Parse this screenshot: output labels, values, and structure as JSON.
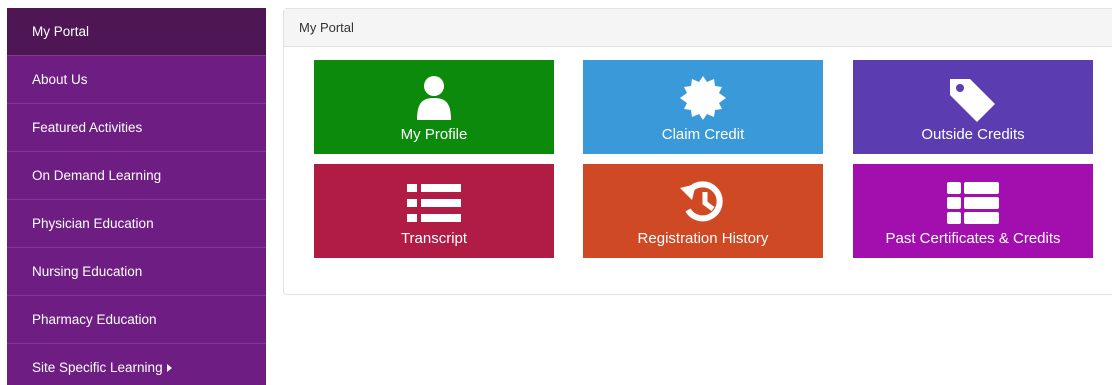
{
  "sidebar": {
    "items": [
      {
        "label": "My Portal"
      },
      {
        "label": "About Us"
      },
      {
        "label": "Featured Activities"
      },
      {
        "label": "On Demand Learning"
      },
      {
        "label": "Physician Education"
      },
      {
        "label": "Nursing Education"
      },
      {
        "label": "Pharmacy Education"
      },
      {
        "label": "Site Specific Learning"
      }
    ]
  },
  "panel": {
    "title": "My Portal"
  },
  "tiles": [
    {
      "label": "My Profile",
      "icon": "user-icon",
      "color": "#0b8a0b"
    },
    {
      "label": "Claim Credit",
      "icon": "certificate-icon",
      "color": "#3a9ad9"
    },
    {
      "label": "Outside Credits",
      "icon": "tag-icon",
      "color": "#5b3db1"
    },
    {
      "label": "Transcript",
      "icon": "list-icon",
      "color": "#b01c43"
    },
    {
      "label": "Registration History",
      "icon": "history-icon",
      "color": "#cf4a24"
    },
    {
      "label": "Past Certificates & Credits",
      "icon": "th-list-icon",
      "color": "#a20fae"
    }
  ],
  "colors": {
    "sidebar_bg": "#6e1e82",
    "sidebar_active": "#4e1655"
  }
}
